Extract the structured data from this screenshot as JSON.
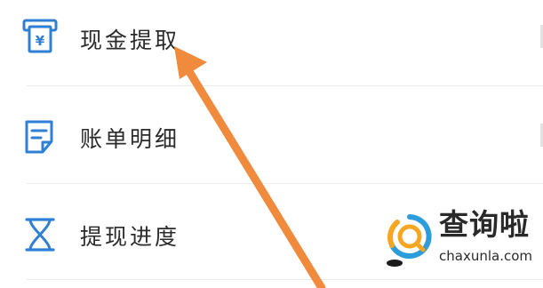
{
  "menu": {
    "items": [
      {
        "label": "现金提取",
        "icon": "cash-register-icon"
      },
      {
        "label": "账单明细",
        "icon": "document-icon"
      },
      {
        "label": "提现进度",
        "icon": "hourglass-icon"
      }
    ]
  },
  "annotation": {
    "arrow_icon": "arrow-icon",
    "arrow_color": "#f08a3c"
  },
  "watermark": {
    "brand_cn": "查询啦",
    "site": "chaxunla.com",
    "logo_icon": "magnifier-logo",
    "accent_color": "#f5a623",
    "ring_color": "#2d9cdb"
  },
  "colors": {
    "icon_blue": "#2f7fd4",
    "label_text": "#2b2b2b",
    "divider": "#ececec"
  }
}
